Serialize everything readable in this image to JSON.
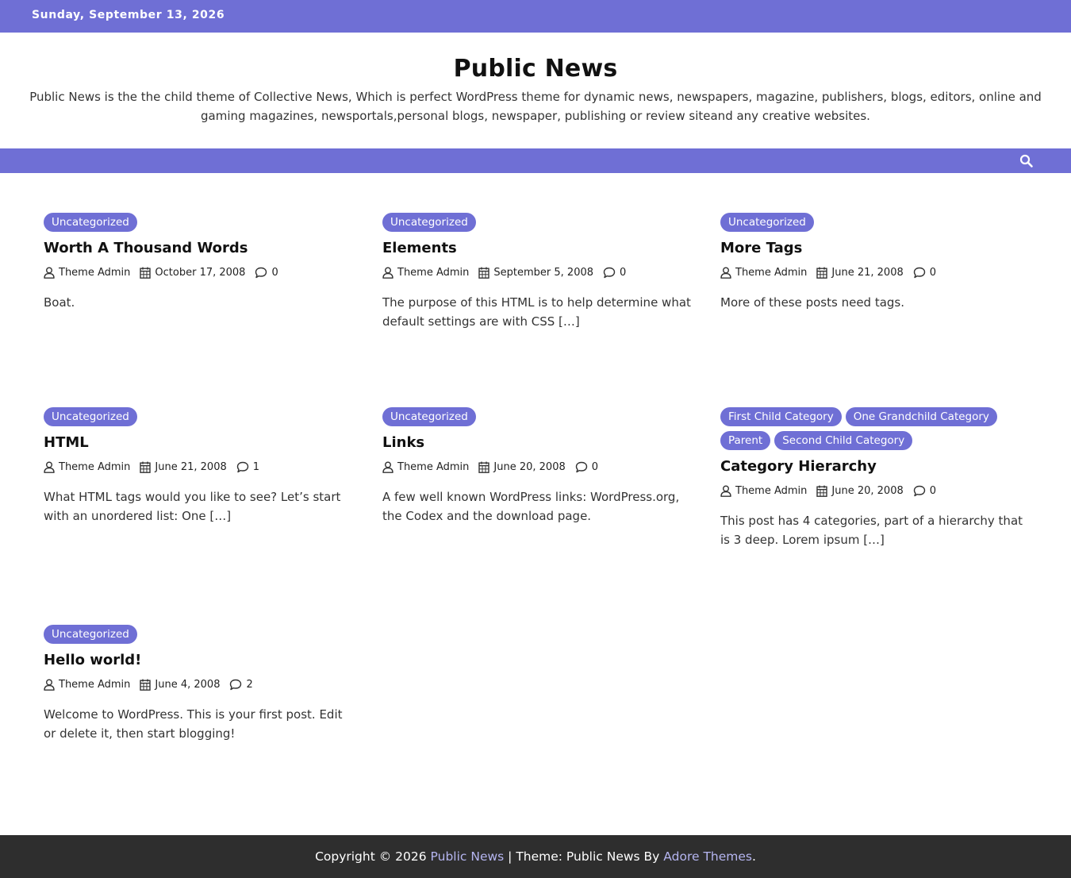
{
  "topbar": {
    "date": "Sunday, September 13, 2026"
  },
  "site": {
    "title": "Public News",
    "description": "Public News is the the child theme of Collective News, Which is perfect WordPress theme for dynamic news, newspapers, magazine, publishers, blogs, editors, online and gaming magazines, newsportals,personal blogs, newspaper, publishing or review siteand any creative websites."
  },
  "nav": {
    "search_icon": "search-icon"
  },
  "posts": [
    {
      "categories": [
        "Uncategorized"
      ],
      "title": "Worth A Thousand Words",
      "author": "Theme Admin",
      "date": "October 17, 2008",
      "comments": "0",
      "excerpt": "Boat."
    },
    {
      "categories": [
        "Uncategorized"
      ],
      "title": "Elements",
      "author": "Theme Admin",
      "date": "September 5, 2008",
      "comments": "0",
      "excerpt": "The purpose of this HTML is to help determine what default settings are with CSS […]"
    },
    {
      "categories": [
        "Uncategorized"
      ],
      "title": "More Tags",
      "author": "Theme Admin",
      "date": "June 21, 2008",
      "comments": "0",
      "excerpt": "More of these posts need tags."
    },
    {
      "categories": [
        "Uncategorized"
      ],
      "title": "HTML",
      "author": "Theme Admin",
      "date": "June 21, 2008",
      "comments": "1",
      "excerpt": "What HTML tags would you like to see? Let’s start with an unordered list: One […]"
    },
    {
      "categories": [
        "Uncategorized"
      ],
      "title": "Links",
      "author": "Theme Admin",
      "date": "June 20, 2008",
      "comments": "0",
      "excerpt": "A few well known WordPress links: WordPress.org, the Codex and the download page."
    },
    {
      "categories": [
        "First Child Category",
        "One Grandchild Category",
        "Parent",
        "Second Child Category"
      ],
      "title": "Category Hierarchy",
      "author": "Theme Admin",
      "date": "June 20, 2008",
      "comments": "0",
      "excerpt": "This post has 4 categories, part of a hierarchy that is 3 deep. Lorem ipsum […]"
    },
    {
      "categories": [
        "Uncategorized"
      ],
      "title": "Hello world!",
      "author": "Theme Admin",
      "date": "June 4, 2008",
      "comments": "2",
      "excerpt": "Welcome to WordPress. This is your first post. Edit or delete it, then start blogging!"
    }
  ],
  "footer": {
    "copyright": "Copyright © 2026",
    "site_link": "Public News",
    "theme_text": "| Theme: Public News By",
    "author_link": "Adore Themes",
    "period": "."
  },
  "colors": {
    "accent": "#6f6fd5",
    "footer_bg": "#2e2e2e",
    "footer_link": "#b5b5f0"
  }
}
